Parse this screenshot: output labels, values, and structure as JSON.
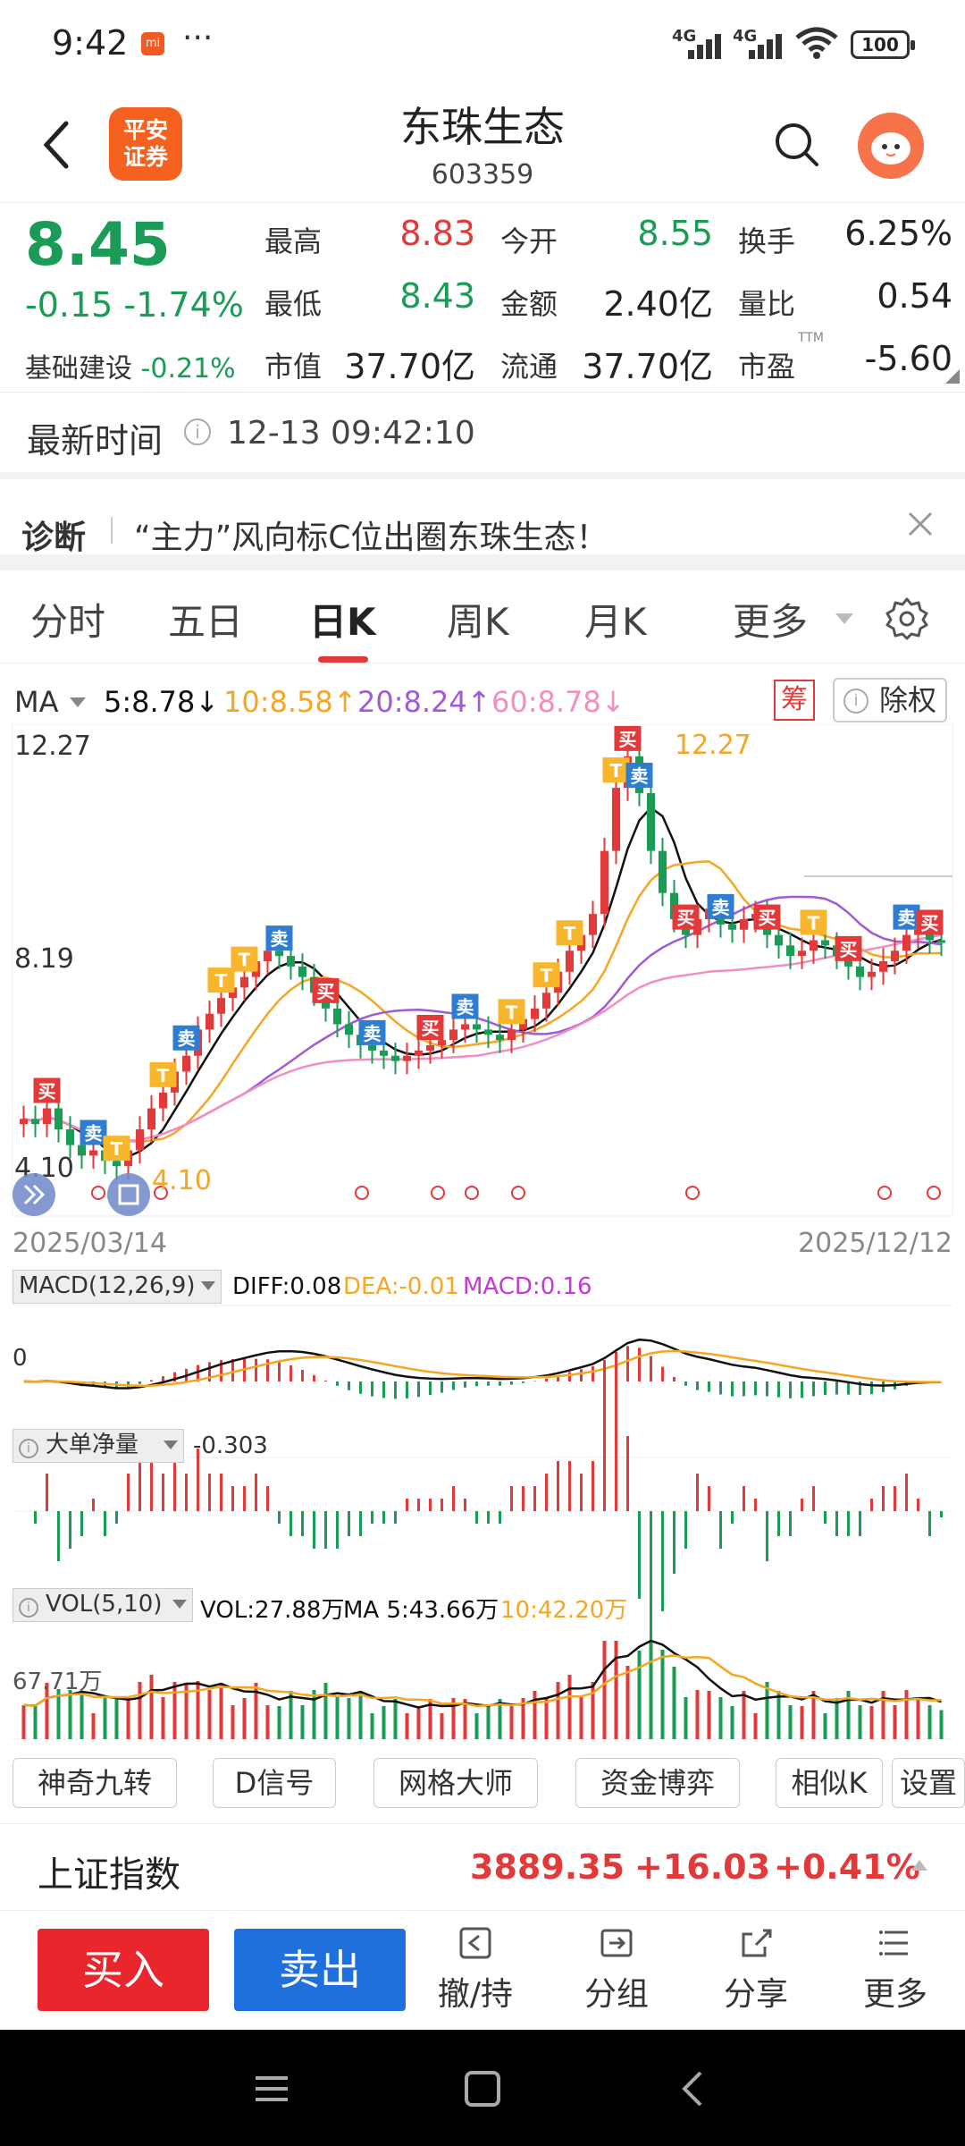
{
  "status": {
    "time": "9:42",
    "net1": "4G",
    "net2": "4G",
    "battery": "100"
  },
  "header": {
    "logo": "平安证券",
    "logo_line1": "平安",
    "logo_line2": "证券",
    "name": "东珠生态",
    "code": "603359"
  },
  "quote": {
    "price": "8.45",
    "change": "-0.15",
    "change_pct": "-1.74%",
    "sector_label": "基础建设",
    "sector_pct": "-0.21%",
    "high_label": "最高",
    "high": "8.83",
    "open_label": "今开",
    "open": "8.55",
    "turnover_label": "换手",
    "turnover": "6.25%",
    "low_label": "最低",
    "low": "8.43",
    "amount_label": "金额",
    "amount": "2.40亿",
    "vol_ratio_label": "量比",
    "vol_ratio": "0.54",
    "mcap_label": "市值",
    "mcap": "37.70亿",
    "float_label": "流通",
    "float": "37.70亿",
    "pe_label": "市盈",
    "pe_sup": "TTM",
    "pe": "-5.60"
  },
  "latest": {
    "label": "最新时间",
    "value": "12-13 09:42:10"
  },
  "diagnosis": {
    "label": "诊断",
    "text": "“主力”风向标C位出圈东珠生态！"
  },
  "tabs": [
    "分时",
    "五日",
    "日K",
    "周K",
    "月K",
    "更多"
  ],
  "active_tab": "日K",
  "ma": {
    "label": "MA",
    "ma5": "5:8.78↓",
    "ma10": "10:8.58↑",
    "ma20": "20:8.24↑",
    "ma60": "60:8.78↓"
  },
  "chart_buttons": {
    "chou": "筹",
    "chuquan": "除权"
  },
  "chart_data": {
    "type": "candlestick",
    "y_max_label": "12.27",
    "y_mid_label": "8.19",
    "y_min_label": "4.10",
    "peak_label": "12.27",
    "trough_label": "4.10",
    "date_start": "2025/03/14",
    "date_end": "2025/12/12",
    "closes": [
      5.1,
      5.0,
      5.3,
      4.9,
      4.6,
      4.4,
      4.5,
      4.3,
      4.2,
      4.5,
      4.9,
      5.3,
      5.6,
      6.0,
      6.3,
      6.8,
      7.1,
      7.4,
      7.6,
      7.8,
      8.1,
      8.3,
      8.2,
      8.0,
      7.8,
      7.5,
      7.2,
      6.9,
      6.7,
      6.5,
      6.4,
      6.3,
      6.2,
      6.3,
      6.4,
      6.5,
      6.6,
      6.8,
      6.9,
      6.8,
      6.7,
      6.6,
      6.8,
      7.0,
      7.2,
      7.5,
      7.9,
      8.3,
      8.6,
      9.0,
      10.2,
      11.4,
      12.0,
      11.3,
      10.2,
      9.4,
      8.9,
      8.6,
      8.9,
      9.1,
      8.8,
      8.7,
      8.9,
      9.0,
      8.6,
      8.4,
      8.2,
      8.3,
      8.5,
      8.4,
      8.2,
      8.0,
      7.8,
      7.9,
      8.1,
      8.3,
      8.6,
      8.7,
      8.5,
      8.45
    ],
    "trade_signals": {
      "buy": "买",
      "sell": "卖",
      "t": "T"
    }
  },
  "macd": {
    "label": "MACD(12,26,9)",
    "diff": "DIFF:0.08",
    "dea": "DEA:-0.01",
    "macd": "MACD:0.16",
    "zero": "0"
  },
  "bigorder": {
    "label": "大单净量",
    "value": "-0.303"
  },
  "vol": {
    "label": "VOL(5,10)",
    "vol": "VOL:27.88万",
    "ma5": "MA 5:43.66万",
    "ma10": "10:42.20万",
    "ymax": "67.71万"
  },
  "tools": [
    "神奇九转",
    "D信号",
    "网格大师",
    "资金博弈",
    "相似K",
    "设置"
  ],
  "index": {
    "name": "上证指数",
    "value": "3889.35",
    "change": "+16.03",
    "pct": "+0.41%"
  },
  "bottom": {
    "buy": "买入",
    "sell": "卖出",
    "hold": "撤/持",
    "group": "分组",
    "share": "分享",
    "more": "更多"
  },
  "colors": {
    "up": "#e23a3a",
    "down": "#1a9b56",
    "ma5": "#111111",
    "ma10": "#f5a623",
    "ma20": "#a05ad6",
    "ma60": "#f08fc0",
    "buy_btn": "#e8262b",
    "sell_btn": "#1f6fdc"
  }
}
